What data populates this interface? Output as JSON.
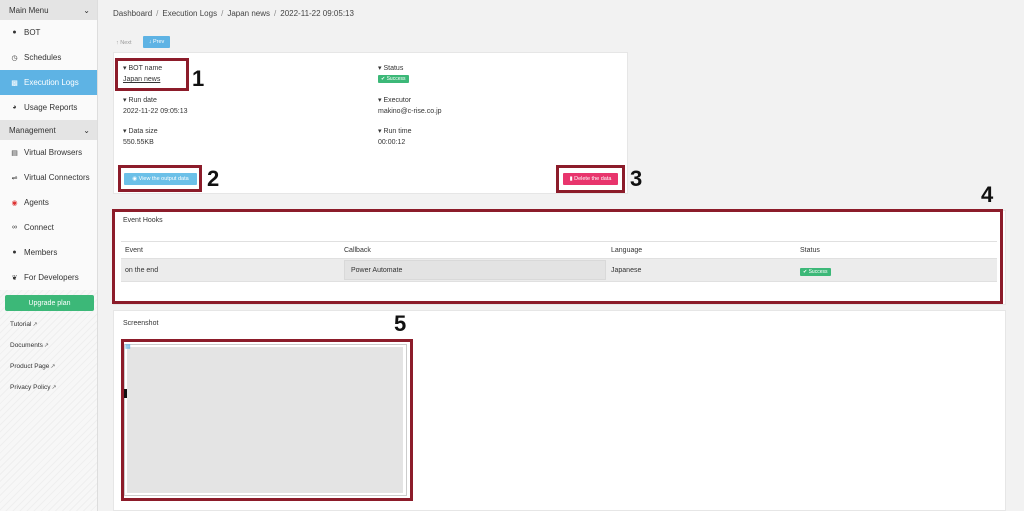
{
  "sidebar": {
    "main_menu_label": "Main Menu",
    "items": [
      {
        "label": "BOT",
        "icon": "robot-icon"
      },
      {
        "label": "Schedules",
        "icon": "clock-icon"
      },
      {
        "label": "Execution Logs",
        "icon": "document-icon",
        "active": true
      },
      {
        "label": "Usage Reports",
        "icon": "chart-pie-icon"
      }
    ],
    "management_label": "Management",
    "management_items": [
      {
        "label": "Virtual Browsers",
        "icon": "browser-icon"
      },
      {
        "label": "Virtual Connectors",
        "icon": "connector-icon"
      },
      {
        "label": "Agents",
        "icon": "agent-icon"
      },
      {
        "label": "Connect",
        "icon": "link-icon"
      },
      {
        "label": "Members",
        "icon": "users-icon"
      },
      {
        "label": "For Developers",
        "icon": "wrench-icon"
      }
    ],
    "upgrade_label": "Upgrade plan",
    "links": [
      "Tutorial",
      "Documents",
      "Product Page",
      "Privacy Policy"
    ]
  },
  "breadcrumb": [
    "Dashboard",
    "Execution Logs",
    "Japan news",
    "2022-11-22 09:05:13"
  ],
  "pager": {
    "next_label": "Next",
    "prev_label": "Prev"
  },
  "details": {
    "bot_name_label": "BOT name",
    "bot_name": "Japan news",
    "status_label": "Status",
    "status": "Success",
    "run_date_label": "Run date",
    "run_date": "2022-11-22 09:05:13",
    "executor_label": "Executor",
    "executor": "makino@c-rise.co.jp",
    "data_size_label": "Data size",
    "data_size": "550.55KB",
    "run_time_label": "Run time",
    "run_time": "00:00:12",
    "view_output_label": "View the output data",
    "delete_label": "Delete the data"
  },
  "event_hooks": {
    "title": "Event Hooks",
    "columns": [
      "Event",
      "Callback",
      "Language",
      "Status"
    ],
    "rows": [
      {
        "event": "on the end",
        "callback": "Power Automate",
        "language": "Japanese",
        "status": "Success"
      }
    ]
  },
  "screenshot": {
    "title": "Screenshot"
  },
  "annotations": [
    "1",
    "2",
    "3",
    "4",
    "5"
  ],
  "colors": {
    "accent": "#5eb3e4",
    "success": "#3cb878",
    "danger": "#e8356d",
    "highlight": "#8c1c2a"
  }
}
